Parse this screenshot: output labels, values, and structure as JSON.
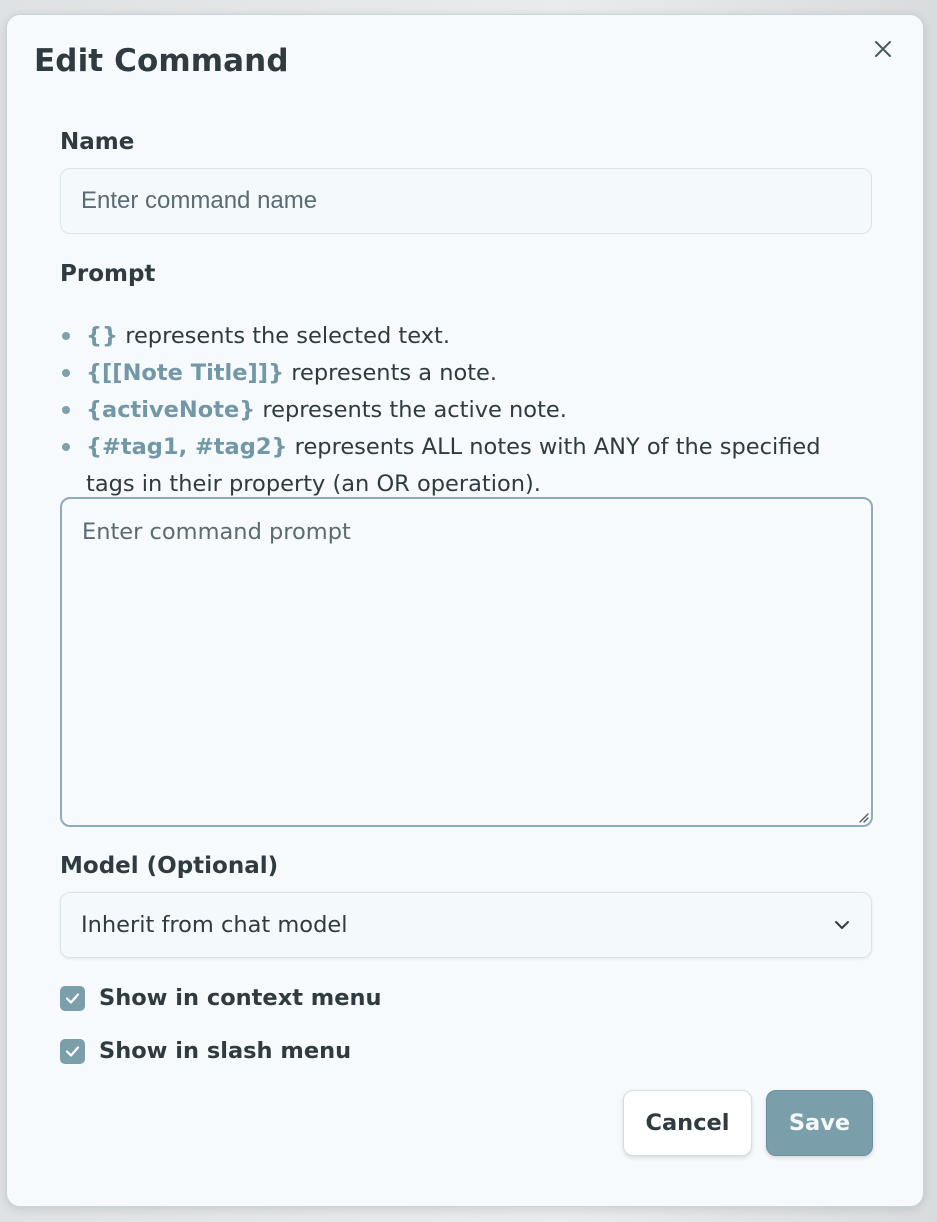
{
  "dialog": {
    "title": "Edit Command",
    "close_icon": "close-icon"
  },
  "name_field": {
    "label": "Name",
    "value": "",
    "placeholder": "Enter command name"
  },
  "prompt_field": {
    "label": "Prompt",
    "hints": [
      {
        "code": "{}",
        "text": " represents the selected text."
      },
      {
        "code": "{[[Note Title]]}",
        "text": " represents a note."
      },
      {
        "code": "{activeNote}",
        "text": " represents the active note."
      },
      {
        "code": "{#tag1, #tag2}",
        "text": " represents ALL notes with ANY of the specified tags in their property (an OR operation)."
      }
    ],
    "value": "",
    "placeholder": "Enter command prompt"
  },
  "model_field": {
    "label": "Model (Optional)",
    "selected": "Inherit from chat model",
    "icon": "chevron-down-icon"
  },
  "options": {
    "context_menu": {
      "label": "Show in context menu",
      "checked": true
    },
    "slash_menu": {
      "label": "Show in slash menu",
      "checked": true
    }
  },
  "actions": {
    "cancel_label": "Cancel",
    "save_label": "Save"
  },
  "colors": {
    "accent": "#7b9eab",
    "hint_code": "#7297a6",
    "text": "#2f3b40",
    "dialog_bg": "#f6fafc"
  }
}
